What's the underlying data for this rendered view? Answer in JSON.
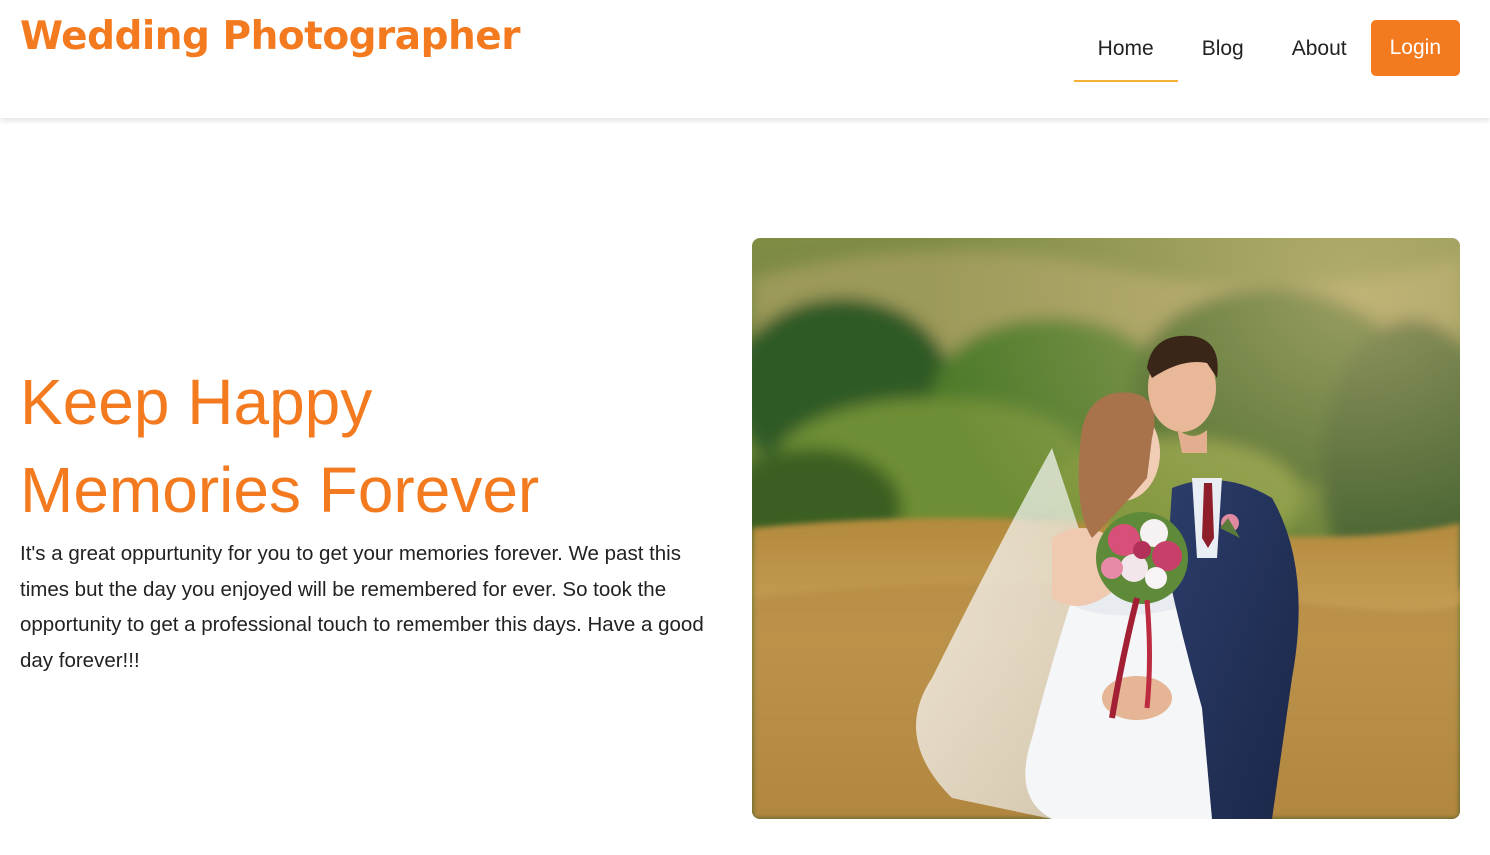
{
  "header": {
    "brand": "Wedding Photographer",
    "nav": {
      "home": "Home",
      "blog": "Blog",
      "about": "About",
      "login": "Login"
    }
  },
  "hero": {
    "title_line1": "Keep Happy",
    "title_line2": "Memories Forever",
    "description": "It's a great oppurtunity for you to get your memories forever. We past this times but the day you enjoyed will be remembered for ever. So took the opportunity to get a professional touch to remember this days. Have a good day forever!!!",
    "image_alt": "Bride and groom embracing in a golden meadow"
  },
  "colors": {
    "accent": "#f47a1f",
    "nav_underline": "#f4b23a",
    "text": "#222222"
  }
}
